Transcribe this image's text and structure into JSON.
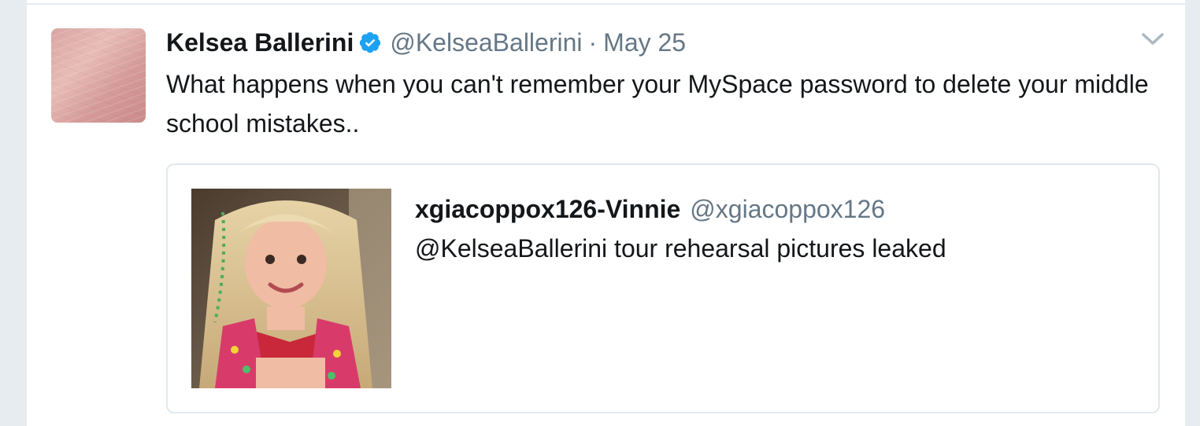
{
  "tweet": {
    "author_name": "Kelsea Ballerini",
    "author_handle": "@KelseaBallerini",
    "separator": "·",
    "timestamp": "May 25",
    "text": "What happens when you can't remember your MySpace password to delete your middle school mistakes..",
    "verified": true
  },
  "quoted_tweet": {
    "author_name": "xgiacoppox126-Vinnie",
    "author_handle": "@xgiacoppox126",
    "text": "@KelseaBallerini tour rehearsal pictures leaked"
  },
  "icons": {
    "verified": "verified-badge-icon",
    "menu": "chevron-down-icon"
  },
  "colors": {
    "primary_text": "#14171a",
    "secondary_text": "#657786",
    "verified_blue": "#1da1f2",
    "border": "#e1e8ed",
    "background": "#e6ecf0"
  }
}
